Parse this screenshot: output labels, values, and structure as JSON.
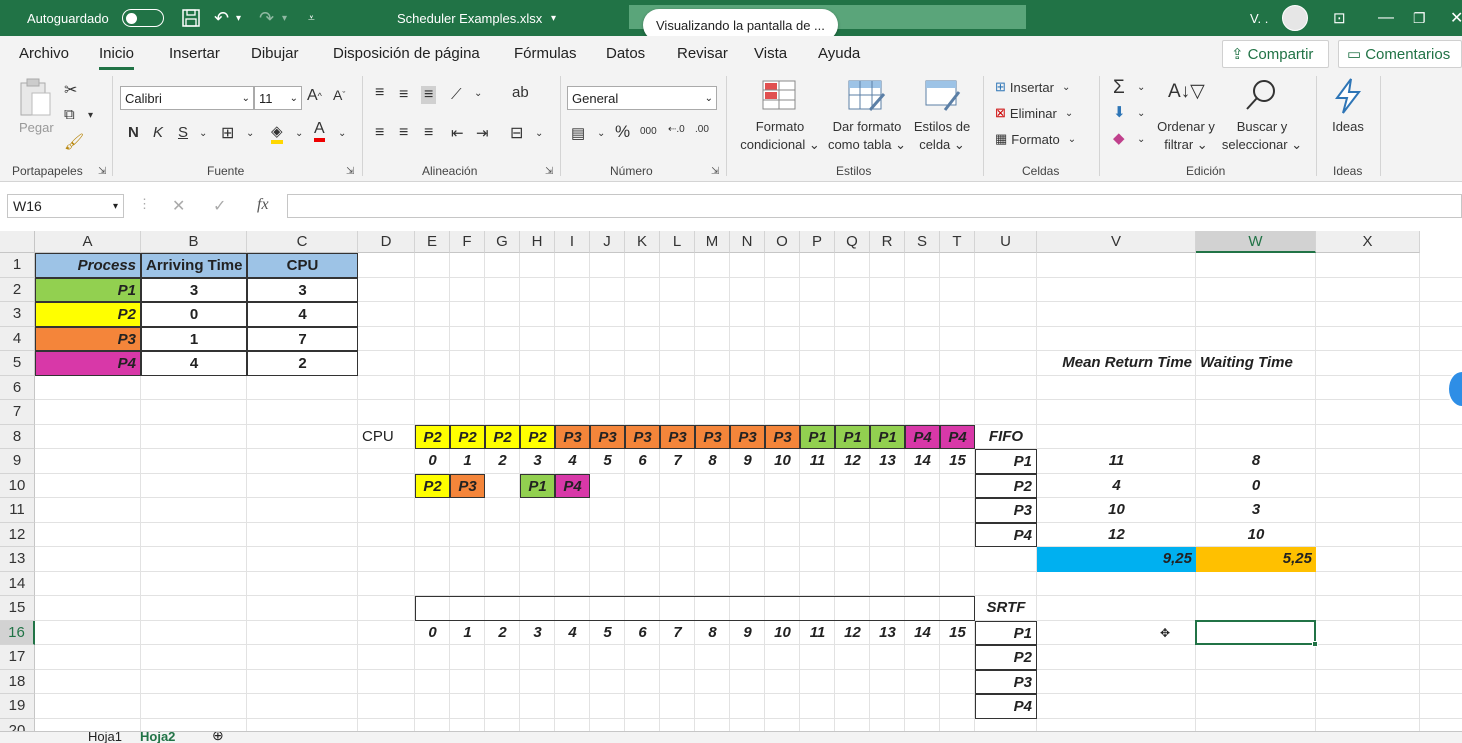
{
  "title_bar": {
    "autosave_label": "Autoguardado",
    "file_name": "Scheduler Examples.xlsx",
    "share_banner": "Visualizando la pantalla de ...",
    "user_initial": "V. ."
  },
  "menu": {
    "items": [
      "Archivo",
      "Inicio",
      "Insertar",
      "Dibujar",
      "Disposición de página",
      "Fórmulas",
      "Datos",
      "Revisar",
      "Vista",
      "Ayuda"
    ],
    "active": "Inicio",
    "share": "Compartir",
    "comments": "Comentarios"
  },
  "ribbon": {
    "groups": [
      "Portapapeles",
      "Fuente",
      "Alineación",
      "Número",
      "Estilos",
      "Celdas",
      "Edición",
      "Ideas"
    ],
    "paste": "Pegar",
    "font_name": "Calibri",
    "font_size": "11",
    "bold": "N",
    "italic": "K",
    "underline": "S",
    "number_format": "General",
    "cond_format": [
      "Formato",
      "condicional"
    ],
    "format_table": [
      "Dar formato",
      "como tabla"
    ],
    "cell_styles": [
      "Estilos de",
      "celda"
    ],
    "insert": "Insertar",
    "delete": "Eliminar",
    "format": "Formato",
    "sort_filter": [
      "Ordenar y",
      "filtrar"
    ],
    "find_select": [
      "Buscar y",
      "seleccionar"
    ],
    "ideas": "Ideas"
  },
  "formula_bar": {
    "name_box": "W16",
    "fx": "fx",
    "value": ""
  },
  "sheet": {
    "columns": [
      "A",
      "B",
      "C",
      "D",
      "E",
      "F",
      "G",
      "H",
      "I",
      "J",
      "K",
      "L",
      "M",
      "N",
      "O",
      "P",
      "Q",
      "R",
      "S",
      "T",
      "U",
      "V",
      "W",
      "X"
    ],
    "selected_column": "W",
    "rows": [
      "1",
      "2",
      "3",
      "4",
      "5",
      "6",
      "7",
      "8",
      "9",
      "10",
      "11",
      "12",
      "13",
      "14",
      "15",
      "16",
      "17",
      "18",
      "19",
      "20"
    ],
    "selected_row": "16",
    "table_headers": [
      "Process",
      "Arriving Time",
      "CPU"
    ],
    "processes": [
      {
        "name": "P1",
        "arrival": "3",
        "cpu": "3"
      },
      {
        "name": "P2",
        "arrival": "0",
        "cpu": "4"
      },
      {
        "name": "P3",
        "arrival": "1",
        "cpu": "7"
      },
      {
        "name": "P4",
        "arrival": "4",
        "cpu": "2"
      }
    ],
    "cpu_label": "CPU",
    "timeline": [
      "P2",
      "P2",
      "P2",
      "P2",
      "P3",
      "P3",
      "P3",
      "P3",
      "P3",
      "P3",
      "P3",
      "P1",
      "P1",
      "P1",
      "P4",
      "P4"
    ],
    "times": [
      "0",
      "1",
      "2",
      "3",
      "4",
      "5",
      "6",
      "7",
      "8",
      "9",
      "10",
      "11",
      "12",
      "13",
      "14",
      "15"
    ],
    "queue": [
      "P2",
      "P3",
      "",
      "P1",
      "P4"
    ],
    "fifo_label": "FIFO",
    "srtf_label": "SRTF",
    "mean_return_label": "Mean Return Time",
    "waiting_label": "Waiting Time",
    "fifo_results": [
      {
        "p": "P1",
        "ret": "11",
        "wait": "8"
      },
      {
        "p": "P2",
        "ret": "4",
        "wait": "0"
      },
      {
        "p": "P3",
        "ret": "10",
        "wait": "3"
      },
      {
        "p": "P4",
        "ret": "12",
        "wait": "10"
      }
    ],
    "mean_return": "9,25",
    "mean_wait": "5,25",
    "srtf_procs": [
      "P1",
      "P2",
      "P3",
      "P4"
    ]
  },
  "sheet_tabs": [
    "Hoja1",
    "Hoja2"
  ],
  "colors": {
    "P1": "#92d050",
    "P2": "#ffff00",
    "P3": "#f4853a",
    "P4": "#d838a8",
    "header_blue": "#9dc3e6",
    "mean_blue": "#00b0f0",
    "mean_orange": "#ffc000",
    "excel_green": "#217346"
  }
}
